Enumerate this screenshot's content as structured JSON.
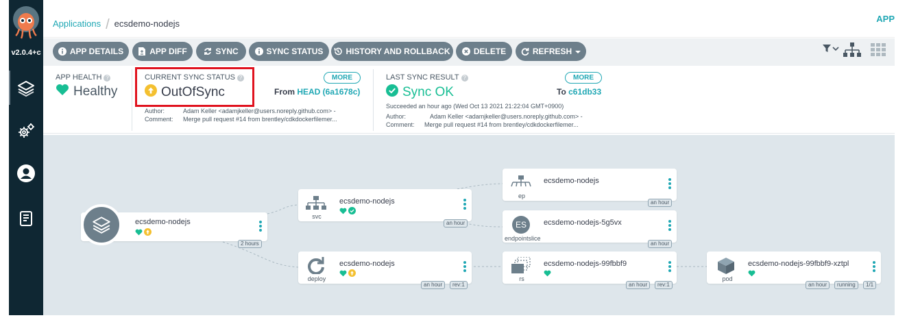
{
  "app": {
    "version": "v2.0.4+c"
  },
  "sidebar": {
    "items": [
      {
        "name": "applications",
        "icon": "layers-icon",
        "active": true
      },
      {
        "name": "settings",
        "icon": "gears-icon",
        "active": false
      },
      {
        "name": "user-info",
        "icon": "user-icon",
        "active": false
      },
      {
        "name": "documentation",
        "icon": "book-icon",
        "active": false
      }
    ]
  },
  "breadcrumb": {
    "parent": "Applications",
    "current": "ecsdemo-nodejs"
  },
  "topright": {
    "label": "APP"
  },
  "toolbar": {
    "app_details": "APP DETAILS",
    "app_diff": "APP DIFF",
    "sync": "SYNC",
    "sync_status": "SYNC STATUS",
    "history": "HISTORY AND ROLLBACK",
    "delete": "DELETE",
    "refresh": "REFRESH"
  },
  "health": {
    "label": "APP HEALTH",
    "value": "Healthy"
  },
  "sync_status": {
    "label": "CURRENT SYNC STATUS",
    "value": "OutOfSync",
    "more": "MORE",
    "from_label": "From",
    "revision": "HEAD (6a1678c)",
    "author_label": "Author:",
    "author": "Adam Keller <adamjkeller@users.noreply.github.com> -",
    "comment_label": "Comment:",
    "comment": "Merge pull request #14 from brentley/cdkdockerfilemer..."
  },
  "last_sync": {
    "label": "LAST SYNC RESULT",
    "value": "Sync OK",
    "more": "MORE",
    "to_label": "To",
    "revision": "c61db33",
    "succeeded": "Succeeded an hour ago (Wed Oct 13 2021 21:22:04 GMT+0900)",
    "author_label": "Author:",
    "author": "Adam Keller <adamjkeller@users.noreply.github.com> -",
    "comment_label": "Comment:",
    "comment": "Merge pull request #14 from brentley/cdkdockerfilemer..."
  },
  "colors": {
    "sidebar": "#0f2733",
    "accent": "#1fa7b4",
    "healthy": "#18be94",
    "outofsync": "#f4c030",
    "button": "#6d7f8b",
    "graph_bg": "#dee6eb",
    "highlight": "#e0121e"
  },
  "graph": {
    "root": {
      "name": "ecsdemo-nodejs",
      "age": "2 hours"
    },
    "svc": {
      "name": "ecsdemo-nodejs",
      "kind": "svc",
      "age": "an hour"
    },
    "deploy": {
      "name": "ecsdemo-nodejs",
      "kind": "deploy",
      "age": "an hour",
      "rev": "rev:1"
    },
    "ep": {
      "name": "ecsdemo-nodejs",
      "kind": "ep",
      "age": "an hour"
    },
    "endpointslice": {
      "name": "ecsdemo-nodejs-5g5vx",
      "kind": "endpointslice",
      "badge": "ES",
      "age": "an hour"
    },
    "rs": {
      "name": "ecsdemo-nodejs-99fbbf9",
      "kind": "rs",
      "age": "an hour",
      "rev": "rev:1"
    },
    "pod": {
      "name": "ecsdemo-nodejs-99fbbf9-xztpl",
      "kind": "pod",
      "age": "an hour",
      "status": "running",
      "ready": "1/1"
    }
  }
}
